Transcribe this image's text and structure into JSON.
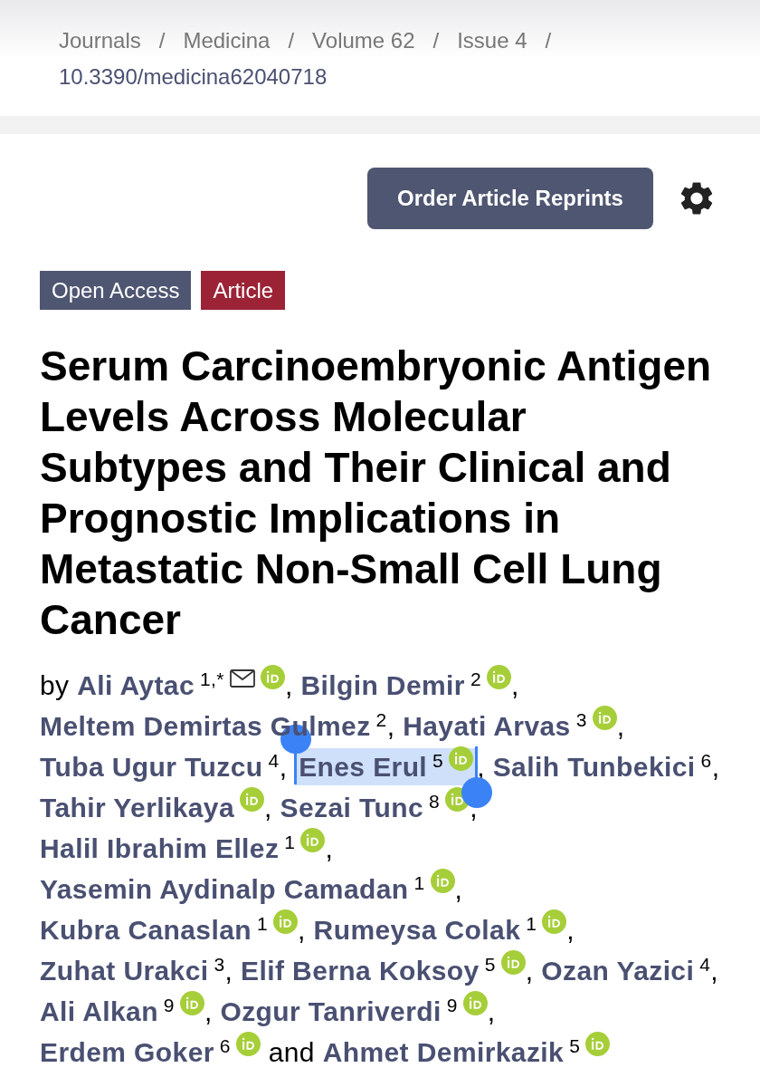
{
  "breadcrumb": {
    "items": [
      "Journals",
      "Medicina",
      "Volume 62",
      "Issue 4"
    ],
    "separator": "/",
    "current": "10.3390/medicina62040718"
  },
  "actions": {
    "reprints_button": "Order Article Reprints"
  },
  "badges": [
    {
      "label": "Open Access",
      "kind": "access"
    },
    {
      "label": "Article",
      "kind": "type"
    }
  ],
  "title": "Serum Carcinoembryonic Antigen Levels Across Molecular Subtypes and Their Clinical and Prognostic Implications in Metastatic Non-Small Cell Lung Cancer",
  "authors_prefix": "by",
  "authors": [
    {
      "name": "Ali Aytac",
      "affiliation": "1,*",
      "email": true,
      "orcid": true,
      "selected": false,
      "after": ","
    },
    {
      "name": "Bilgin Demir",
      "affiliation": "2",
      "email": false,
      "orcid": true,
      "selected": false,
      "after": ","
    },
    {
      "name": "Meltem Demirtas Gulmez",
      "affiliation": "2",
      "email": false,
      "orcid": false,
      "selected": false,
      "after": ","
    },
    {
      "name": "Hayati Arvas",
      "affiliation": "3",
      "email": false,
      "orcid": true,
      "selected": false,
      "after": ","
    },
    {
      "name": "Tuba Ugur Tuzcu",
      "affiliation": "4",
      "email": false,
      "orcid": false,
      "selected": false,
      "after": ","
    },
    {
      "name": "Enes Erul",
      "affiliation": "5",
      "email": false,
      "orcid": true,
      "selected": true,
      "after": ","
    },
    {
      "name": "Salih Tunbekici",
      "affiliation": "6",
      "email": false,
      "orcid": false,
      "selected": false,
      "after": ","
    },
    {
      "name": "Tahir Yerlikaya",
      "email": false,
      "orcid": true,
      "selected": false,
      "after": ","
    },
    {
      "name": "Sezai Tunc",
      "affiliation": "8",
      "email": false,
      "orcid": true,
      "selected": false,
      "after": ","
    },
    {
      "name": "Halil Ibrahim Ellez",
      "affiliation": "1",
      "email": false,
      "orcid": true,
      "selected": false,
      "after": ","
    },
    {
      "name": "Yasemin Aydinalp Camadan",
      "affiliation": "1",
      "email": false,
      "orcid": true,
      "selected": false,
      "after": ","
    },
    {
      "name": "Kubra Canaslan",
      "affiliation": "1",
      "email": false,
      "orcid": true,
      "selected": false,
      "after": ","
    },
    {
      "name": "Rumeysa Colak",
      "affiliation": "1",
      "email": false,
      "orcid": true,
      "selected": false,
      "after": ","
    },
    {
      "name": "Zuhat Urakci",
      "affiliation": "3",
      "email": false,
      "orcid": false,
      "selected": false,
      "after": ","
    },
    {
      "name": "Elif Berna Koksoy",
      "affiliation": "5",
      "email": false,
      "orcid": true,
      "selected": false,
      "after": ","
    },
    {
      "name": "Ozan Yazici",
      "affiliation": "4",
      "email": false,
      "orcid": false,
      "selected": false,
      "after": ","
    },
    {
      "name": "Ali Alkan",
      "affiliation": "9",
      "email": false,
      "orcid": true,
      "selected": false,
      "after": ","
    },
    {
      "name": "Ozgur Tanriverdi",
      "affiliation": "9",
      "email": false,
      "orcid": true,
      "selected": false,
      "after": ","
    },
    {
      "name": "Erdem Goker",
      "affiliation": "6",
      "email": false,
      "orcid": true,
      "selected": false,
      "after": "and"
    },
    {
      "name": "Ahmet Demirkazik",
      "affiliation": "5",
      "email": false,
      "orcid": true,
      "selected": false
    }
  ]
}
